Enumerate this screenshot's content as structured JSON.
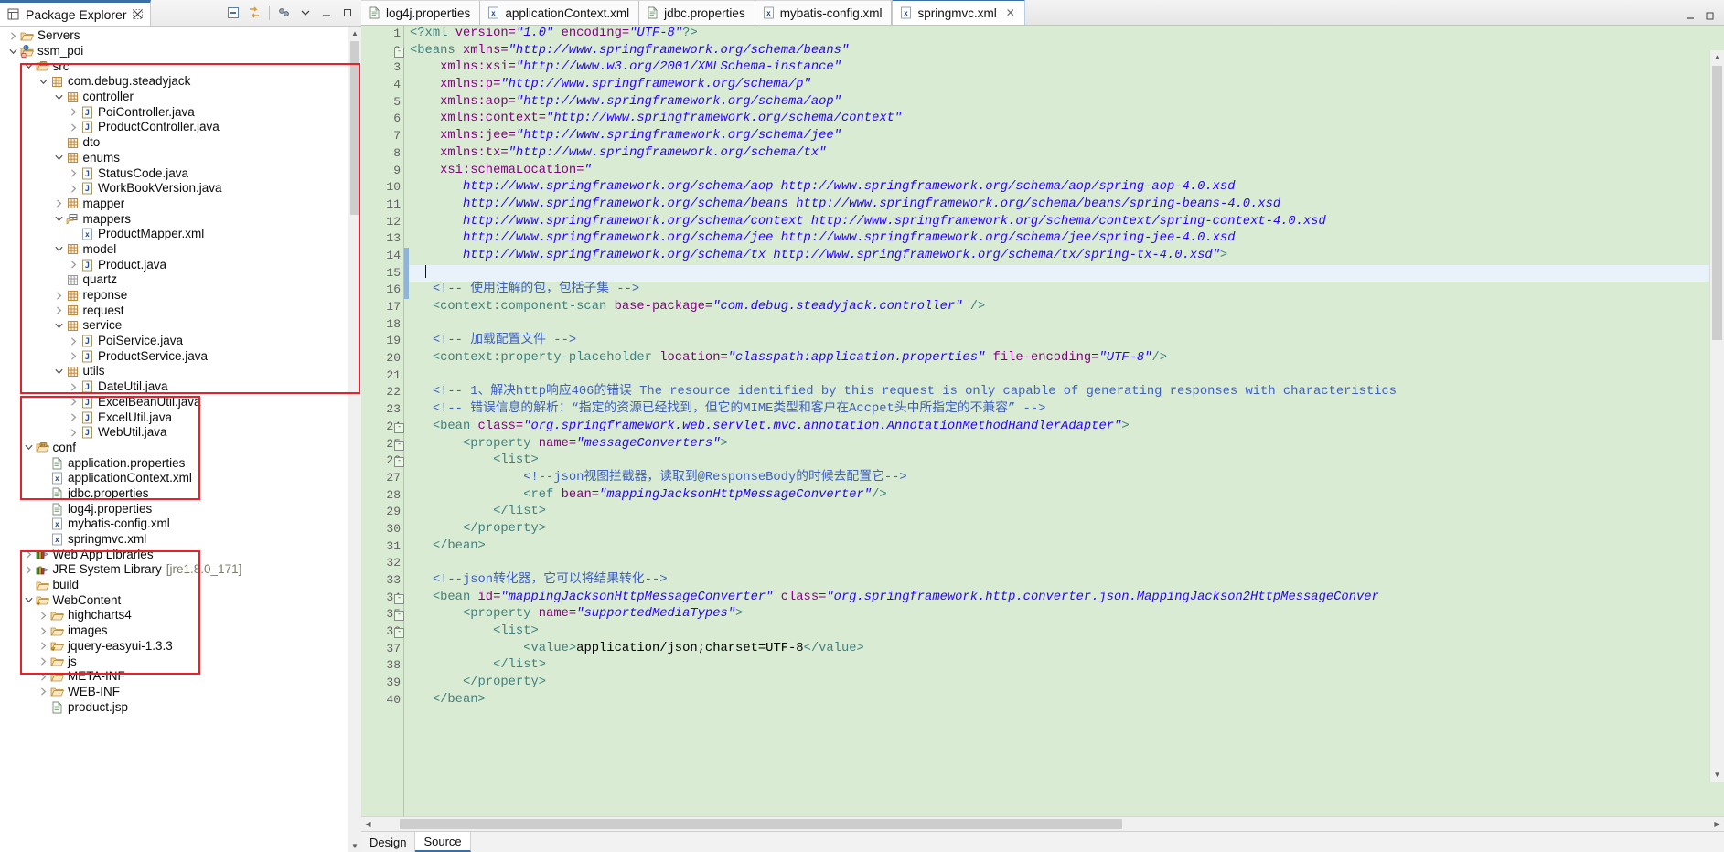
{
  "explorer": {
    "tab_title": "Package Explorer",
    "toolbar": [
      {
        "name": "collapse-all-icon",
        "tooltip": "Collapse All"
      },
      {
        "name": "link-with-editor-icon",
        "tooltip": "Link with Editor"
      },
      {
        "name": "view-menu-icon",
        "tooltip": "View Menu"
      },
      {
        "name": "minimize-icon",
        "tooltip": "Minimize"
      },
      {
        "name": "maximize-icon",
        "tooltip": "Maximize"
      }
    ],
    "tree": [
      {
        "label": "Servers",
        "indent": 0,
        "twisty": "collapsed",
        "icon": "folder-icon"
      },
      {
        "label": "ssm_poi",
        "indent": 0,
        "twisty": "expanded",
        "icon": "web-project-icon"
      },
      {
        "label": "src",
        "indent": 1,
        "twisty": "expanded",
        "icon": "source-folder-icon"
      },
      {
        "label": "com.debug.steadyjack",
        "indent": 2,
        "twisty": "expanded",
        "icon": "package-icon"
      },
      {
        "label": "controller",
        "indent": 3,
        "twisty": "expanded",
        "icon": "package-icon"
      },
      {
        "label": "PoiController.java",
        "indent": 4,
        "twisty": "collapsed",
        "icon": "java-file-icon"
      },
      {
        "label": "ProductController.java",
        "indent": 4,
        "twisty": "collapsed",
        "icon": "java-file-icon"
      },
      {
        "label": "dto",
        "indent": 3,
        "twisty": "none",
        "icon": "package-icon"
      },
      {
        "label": "enums",
        "indent": 3,
        "twisty": "expanded",
        "icon": "package-icon"
      },
      {
        "label": "StatusCode.java",
        "indent": 4,
        "twisty": "collapsed",
        "icon": "java-file-icon"
      },
      {
        "label": "WorkBookVersion.java",
        "indent": 4,
        "twisty": "collapsed",
        "icon": "java-file-icon"
      },
      {
        "label": "mapper",
        "indent": 3,
        "twisty": "collapsed",
        "icon": "package-icon"
      },
      {
        "label": "mappers",
        "indent": 3,
        "twisty": "expanded",
        "icon": "package-folder-icon"
      },
      {
        "label": "ProductMapper.xml",
        "indent": 4,
        "twisty": "none",
        "icon": "xml-file-icon"
      },
      {
        "label": "model",
        "indent": 3,
        "twisty": "expanded",
        "icon": "package-icon"
      },
      {
        "label": "Product.java",
        "indent": 4,
        "twisty": "collapsed",
        "icon": "java-file-icon"
      },
      {
        "label": "quartz",
        "indent": 3,
        "twisty": "none",
        "icon": "package-empty-icon"
      },
      {
        "label": "reponse",
        "indent": 3,
        "twisty": "collapsed",
        "icon": "package-icon"
      },
      {
        "label": "request",
        "indent": 3,
        "twisty": "collapsed",
        "icon": "package-icon"
      },
      {
        "label": "service",
        "indent": 3,
        "twisty": "expanded",
        "icon": "package-icon"
      },
      {
        "label": "PoiService.java",
        "indent": 4,
        "twisty": "collapsed",
        "icon": "java-file-icon"
      },
      {
        "label": "ProductService.java",
        "indent": 4,
        "twisty": "collapsed",
        "icon": "java-file-icon"
      },
      {
        "label": "utils",
        "indent": 3,
        "twisty": "expanded",
        "icon": "package-icon"
      },
      {
        "label": "DateUtil.java",
        "indent": 4,
        "twisty": "collapsed",
        "icon": "java-file-icon"
      },
      {
        "label": "ExcelBeanUtil.java",
        "indent": 4,
        "twisty": "collapsed",
        "icon": "java-file-icon"
      },
      {
        "label": "ExcelUtil.java",
        "indent": 4,
        "twisty": "collapsed",
        "icon": "java-file-icon"
      },
      {
        "label": "WebUtil.java",
        "indent": 4,
        "twisty": "collapsed",
        "icon": "java-file-icon"
      },
      {
        "label": "conf",
        "indent": 1,
        "twisty": "expanded",
        "icon": "source-folder-icon"
      },
      {
        "label": "application.properties",
        "indent": 2,
        "twisty": "none",
        "icon": "properties-file-icon"
      },
      {
        "label": "applicationContext.xml",
        "indent": 2,
        "twisty": "none",
        "icon": "xml-file-icon"
      },
      {
        "label": "jdbc.properties",
        "indent": 2,
        "twisty": "none",
        "icon": "properties-file-icon"
      },
      {
        "label": "log4j.properties",
        "indent": 2,
        "twisty": "none",
        "icon": "properties-file-icon"
      },
      {
        "label": "mybatis-config.xml",
        "indent": 2,
        "twisty": "none",
        "icon": "xml-file-icon"
      },
      {
        "label": "springmvc.xml",
        "indent": 2,
        "twisty": "none",
        "icon": "xml-file-icon"
      },
      {
        "label": "Web App Libraries",
        "indent": 1,
        "twisty": "collapsed",
        "icon": "library-icon"
      },
      {
        "label": "JRE System Library",
        "suffix": "[jre1.8.0_171]",
        "indent": 1,
        "twisty": "collapsed",
        "icon": "library-icon"
      },
      {
        "label": "build",
        "indent": 1,
        "twisty": "none",
        "icon": "folder-icon"
      },
      {
        "label": "WebContent",
        "indent": 1,
        "twisty": "expanded",
        "icon": "folder-warn-icon"
      },
      {
        "label": "highcharts4",
        "indent": 2,
        "twisty": "collapsed",
        "icon": "folder-icon"
      },
      {
        "label": "images",
        "indent": 2,
        "twisty": "collapsed",
        "icon": "folder-icon"
      },
      {
        "label": "jquery-easyui-1.3.3",
        "indent": 2,
        "twisty": "collapsed",
        "icon": "folder-warn-icon"
      },
      {
        "label": "js",
        "indent": 2,
        "twisty": "collapsed",
        "icon": "folder-icon"
      },
      {
        "label": "META-INF",
        "indent": 2,
        "twisty": "collapsed",
        "icon": "folder-icon"
      },
      {
        "label": "WEB-INF",
        "indent": 2,
        "twisty": "collapsed",
        "icon": "folder-icon"
      },
      {
        "label": "product.jsp",
        "indent": 2,
        "twisty": "none",
        "icon": "jsp-file-icon"
      }
    ],
    "annotation_color": "#e8202a"
  },
  "editor": {
    "tabs": [
      {
        "label": "log4j.properties",
        "icon": "properties-file-icon",
        "active": false
      },
      {
        "label": "applicationContext.xml",
        "icon": "xml-file-icon",
        "active": false
      },
      {
        "label": "jdbc.properties",
        "icon": "properties-file-icon",
        "active": false
      },
      {
        "label": "mybatis-config.xml",
        "icon": "xml-file-icon",
        "active": false
      },
      {
        "label": "springmvc.xml",
        "icon": "xml-file-icon",
        "active": true,
        "close": "✕"
      }
    ],
    "footer_tabs": [
      {
        "label": "Design",
        "selected": false
      },
      {
        "label": "Source",
        "selected": true
      }
    ],
    "current_line": 15,
    "background": "#d9ecd3",
    "current_line_background": "#e9f2fb",
    "lines": [
      {
        "n": 1,
        "fold": "",
        "html": "<span class='tk-proc'>&lt;?xml </span><span class='tk-attr'>version=</span><span class='tk-val'>\"1.0\"</span><span class='tk-attr'> encoding=</span><span class='tk-val'>\"UTF-8\"</span><span class='tk-proc'>?&gt;</span>"
      },
      {
        "n": 2,
        "fold": "-",
        "html": "<span class='tk-tag'>&lt;beans </span><span class='tk-attr'>xmlns=</span><span class='tk-val'>\"http://www.springframework.org/schema/beans\"</span>"
      },
      {
        "n": 3,
        "fold": "",
        "html": "    <span class='tk-attr'>xmlns:xsi=</span><span class='tk-val'>\"http://www.w3.org/2001/XMLSchema-instance\"</span>"
      },
      {
        "n": 4,
        "fold": "",
        "html": "    <span class='tk-attr'>xmlns:p=</span><span class='tk-val'>\"http://www.springframework.org/schema/p\"</span>"
      },
      {
        "n": 5,
        "fold": "",
        "html": "    <span class='tk-attr'>xmlns:aop=</span><span class='tk-val'>\"http://www.springframework.org/schema/aop\"</span>"
      },
      {
        "n": 6,
        "fold": "",
        "html": "    <span class='tk-attr'>xmlns:context=</span><span class='tk-val'>\"http://www.springframework.org/schema/context\"</span>"
      },
      {
        "n": 7,
        "fold": "",
        "html": "    <span class='tk-attr'>xmlns:jee=</span><span class='tk-val'>\"http://www.springframework.org/schema/jee\"</span>"
      },
      {
        "n": 8,
        "fold": "",
        "html": "    <span class='tk-attr'>xmlns:tx=</span><span class='tk-val'>\"http://www.springframework.org/schema/tx\"</span>"
      },
      {
        "n": 9,
        "fold": "",
        "html": "    <span class='tk-attr'>xsi:schemaLocation=</span><span class='tk-val'>\"</span>"
      },
      {
        "n": 10,
        "fold": "",
        "html": "       <span class='tk-val'>http://www.springframework.org/schema/aop http://www.springframework.org/schema/aop/spring-aop-4.0.xsd</span>"
      },
      {
        "n": 11,
        "fold": "",
        "html": "       <span class='tk-val'>http://www.springframework.org/schema/beans http://www.springframework.org/schema/beans/spring-beans-4.0.xsd</span>"
      },
      {
        "n": 12,
        "fold": "",
        "html": "       <span class='tk-val'>http://www.springframework.org/schema/context http://www.springframework.org/schema/context/spring-context-4.0.xsd</span>"
      },
      {
        "n": 13,
        "fold": "",
        "html": "       <span class='tk-val'>http://www.springframework.org/schema/jee http://www.springframework.org/schema/jee/spring-jee-4.0.xsd</span>"
      },
      {
        "n": 14,
        "fold": "",
        "html": "       <span class='tk-val'>http://www.springframework.org/schema/tx http://www.springframework.org/schema/tx/spring-tx-4.0.xsd\"</span><span class='tk-tag'>&gt;</span>"
      },
      {
        "n": 15,
        "fold": "",
        "html": "  <span class='caret'></span>",
        "current": true
      },
      {
        "n": 16,
        "fold": "",
        "html": "   <span class='tk-cmt'>&lt;!-- 使用注解的包，包括子集 --&gt;</span>"
      },
      {
        "n": 17,
        "fold": "",
        "html": "   <span class='tk-tag'>&lt;context:component-scan </span><span class='tk-attr'>base-package=</span><span class='tk-val'>\"com.debug.steadyjack.controller\"</span><span class='tk-tag'> /&gt;</span>"
      },
      {
        "n": 18,
        "fold": "",
        "html": ""
      },
      {
        "n": 19,
        "fold": "",
        "html": "   <span class='tk-cmt'>&lt;!-- 加载配置文件 --&gt;</span>"
      },
      {
        "n": 20,
        "fold": "",
        "html": "   <span class='tk-tag'>&lt;context:property-placeholder </span><span class='tk-attr'>location=</span><span class='tk-val'>\"classpath:application.properties\"</span><span class='tk-attr'> file-encoding=</span><span class='tk-val'>\"UTF-8\"</span><span class='tk-tag'>/&gt;</span>"
      },
      {
        "n": 21,
        "fold": "",
        "html": ""
      },
      {
        "n": 22,
        "fold": "",
        "html": "   <span class='tk-cmt'>&lt;!-- 1、解决http响应406的错误 The resource identified by this request is only capable of generating responses with characteristics</span>"
      },
      {
        "n": 23,
        "fold": "",
        "html": "   <span class='tk-cmt'>&lt;!-- 错误信息的解析：“指定的资源已经找到，但它的MIME类型和客户在Accpet头中所指定的不兼容” --&gt;</span>"
      },
      {
        "n": 24,
        "fold": "-",
        "html": "   <span class='tk-tag'>&lt;bean </span><span class='tk-attr'>class=</span><span class='tk-val'>\"org.springframework.web.servlet.mvc.annotation.AnnotationMethodHandlerAdapter\"</span><span class='tk-tag'>&gt;</span>"
      },
      {
        "n": 25,
        "fold": "-",
        "html": "       <span class='tk-tag'>&lt;property </span><span class='tk-attr'>name=</span><span class='tk-val'>\"messageConverters\"</span><span class='tk-tag'>&gt;</span>"
      },
      {
        "n": 26,
        "fold": "-",
        "html": "           <span class='tk-tag'>&lt;list&gt;</span>"
      },
      {
        "n": 27,
        "fold": "",
        "html": "               <span class='tk-cmt'>&lt;!--json视图拦截器，读取到@ResponseBody的时候去配置它--&gt;</span>"
      },
      {
        "n": 28,
        "fold": "",
        "html": "               <span class='tk-tag'>&lt;ref </span><span class='tk-attr'>bean=</span><span class='tk-val'>\"mappingJacksonHttpMessageConverter\"</span><span class='tk-tag'>/&gt;</span>"
      },
      {
        "n": 29,
        "fold": "",
        "html": "           <span class='tk-tag'>&lt;/list&gt;</span>"
      },
      {
        "n": 30,
        "fold": "",
        "html": "       <span class='tk-tag'>&lt;/property&gt;</span>"
      },
      {
        "n": 31,
        "fold": "",
        "html": "   <span class='tk-tag'>&lt;/bean&gt;</span>"
      },
      {
        "n": 32,
        "fold": "",
        "html": ""
      },
      {
        "n": 33,
        "fold": "",
        "html": "   <span class='tk-cmt'>&lt;!--json转化器，它可以将结果转化--&gt;</span>"
      },
      {
        "n": 34,
        "fold": "-",
        "html": "   <span class='tk-tag'>&lt;bean </span><span class='tk-attr'>id=</span><span class='tk-val'>\"mappingJacksonHttpMessageConverter\"</span><span class='tk-attr'> class=</span><span class='tk-val'>\"org.springframework.http.converter.json.MappingJackson2HttpMessageConver</span>"
      },
      {
        "n": 35,
        "fold": "-",
        "html": "       <span class='tk-tag'>&lt;property </span><span class='tk-attr'>name=</span><span class='tk-val'>\"supportedMediaTypes\"</span><span class='tk-tag'>&gt;</span>"
      },
      {
        "n": 36,
        "fold": "-",
        "html": "           <span class='tk-tag'>&lt;list&gt;</span>"
      },
      {
        "n": 37,
        "fold": "",
        "html": "               <span class='tk-tag'>&lt;value&gt;</span><span class='tk-txt'>application/json;charset=UTF-8</span><span class='tk-tag'>&lt;/value&gt;</span>"
      },
      {
        "n": 38,
        "fold": "",
        "html": "           <span class='tk-tag'>&lt;/list&gt;</span>"
      },
      {
        "n": 39,
        "fold": "",
        "html": "       <span class='tk-tag'>&lt;/property&gt;</span>"
      },
      {
        "n": 40,
        "fold": "",
        "html": "   <span class='tk-tag'>&lt;/bean&gt;</span>"
      }
    ]
  }
}
